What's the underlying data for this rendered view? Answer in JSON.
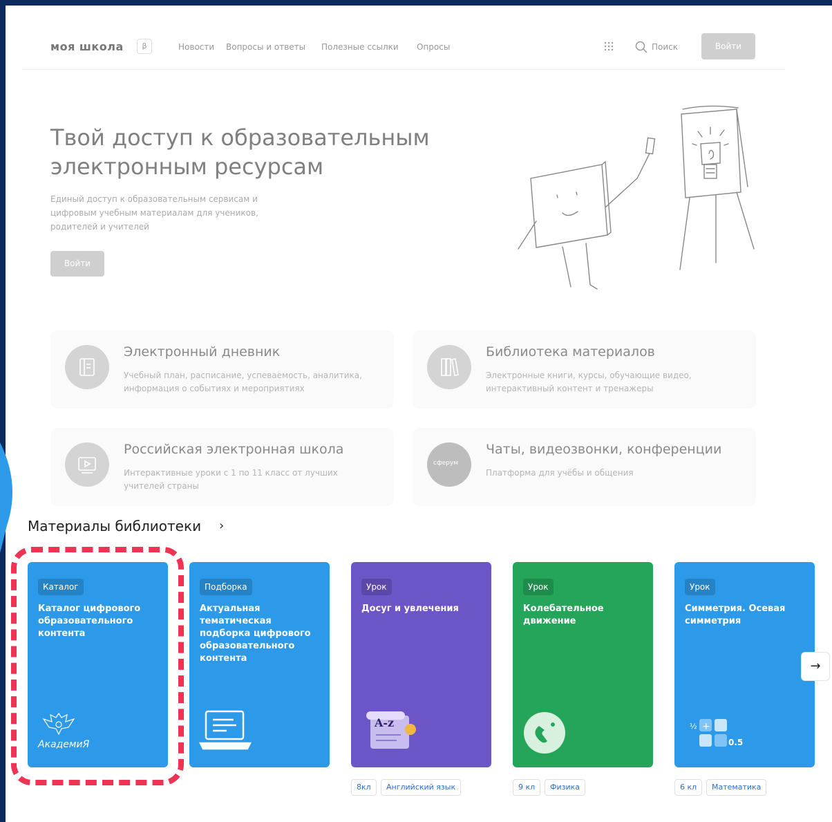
{
  "header": {
    "logo": "моя школа",
    "beta": "β",
    "nav": [
      "Новости",
      "Вопросы и ответы",
      "Полезные ссылки",
      "Опросы"
    ],
    "search_label": "Поиск",
    "login_label": "Войти"
  },
  "hero": {
    "title": "Твой доступ к образовательным электронным ресурсам",
    "subtitle": "Единый доступ к образовательным сервисам и цифровым учебным материалам для учеников, родителей и учителей",
    "login_label": "Войти"
  },
  "services": [
    {
      "title": "Электронный дневник",
      "desc": "Учебный план, расписание, успеваемость, аналитика, информация о событиях и мероприятиях"
    },
    {
      "title": "Библиотека материалов",
      "desc": "Электронные книги, курсы, обучающие видео, интерактивный контент и тренажеры"
    },
    {
      "title": "Российская электронная школа",
      "desc": "Интерактивные уроки с 1 по 11 класс от лучших учителей страны"
    },
    {
      "title": "Чаты, видеозвонки, конференции",
      "desc": "Платформа для учёбы и общения",
      "logo_text": "сферум"
    }
  ],
  "library": {
    "title": "Материалы библиотеки",
    "arrow": "›",
    "next": "→",
    "cards": [
      {
        "badge": "Каталог",
        "title": "Каталог цифрового образовательного контента",
        "color": "#2c9ae8",
        "logo_text": "АкадемиЯ"
      },
      {
        "badge": "Подборка",
        "title": "Актуальная тематическая подборка цифрового образовательного контента",
        "color": "#2c9ae8"
      },
      {
        "badge": "Урок",
        "title": "Досуг и увлечения",
        "color": "#6b55c7",
        "tags": [
          "8кл",
          "Английский язык"
        ]
      },
      {
        "badge": "Урок",
        "title": "Колебательное движение",
        "color": "#25a55a",
        "tags": [
          "9 кл",
          "Физика"
        ]
      },
      {
        "badge": "Урок",
        "title": "Симметрия. Осевая симметрия",
        "color": "#2c9ae8",
        "tags": [
          "6 кл",
          "Математика"
        ]
      }
    ]
  },
  "colors": {
    "frame": "#0d2a5e",
    "highlight": "#ee3355",
    "card_blue": "#2c9ae8",
    "card_purple": "#6b55c7",
    "card_green": "#25a55a"
  }
}
